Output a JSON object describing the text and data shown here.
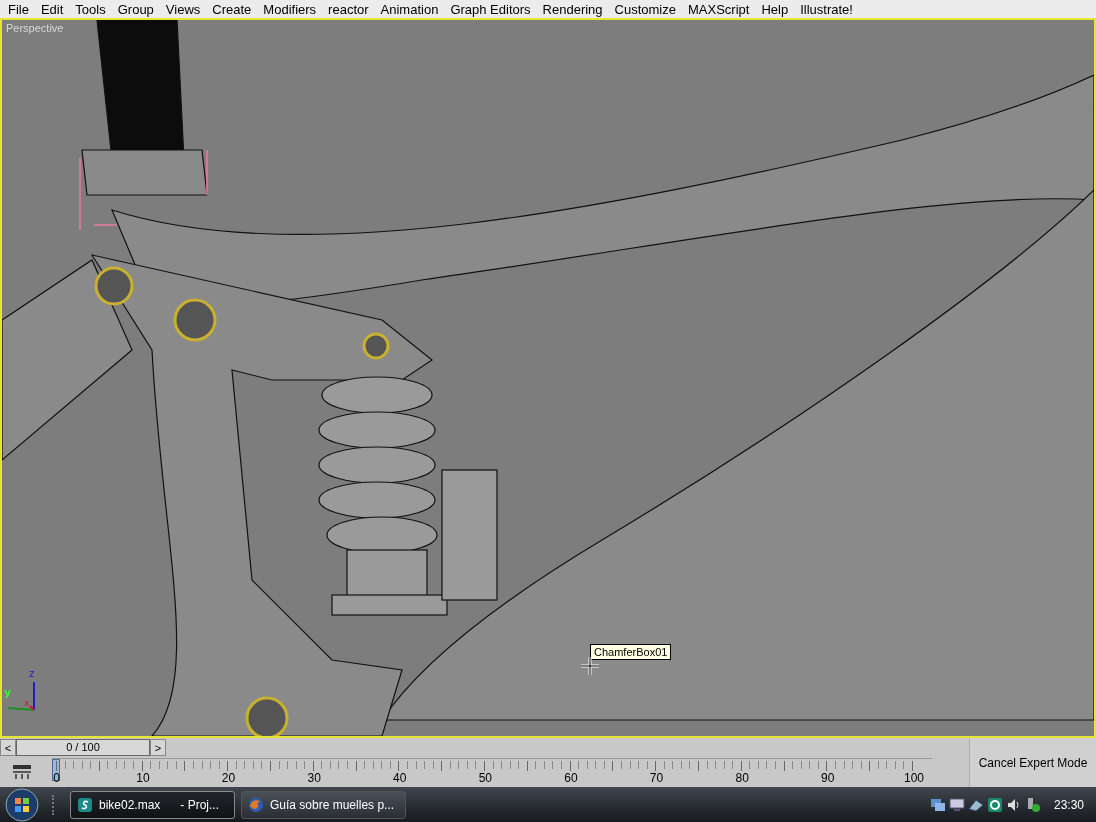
{
  "menu_bar": {
    "items": [
      "File",
      "Edit",
      "Tools",
      "Group",
      "Views",
      "Create",
      "Modifiers",
      "reactor",
      "Animation",
      "Graph Editors",
      "Rendering",
      "Customize",
      "MAXScript",
      "Help",
      "Illustrate!"
    ]
  },
  "viewport": {
    "label": "Perspective",
    "tooltip": "ChamferBox01",
    "axis_labels": {
      "z": "z",
      "y": "y",
      "x": "x"
    }
  },
  "time_slider": {
    "prev": "<",
    "value": "0 / 100",
    "next": ">"
  },
  "track_bar": {
    "labels": [
      "0",
      "10",
      "20",
      "30",
      "40",
      "50",
      "60",
      "70",
      "80",
      "90",
      "100"
    ]
  },
  "expert_mode_button": "Cancel Expert Mode",
  "taskbar": {
    "tasks": [
      {
        "label": "bike02.max      - Proj...",
        "kind": "max",
        "selected": true
      },
      {
        "label": "Guía sobre muelles p...",
        "kind": "browser",
        "selected": false
      }
    ],
    "clock": "23:30"
  }
}
